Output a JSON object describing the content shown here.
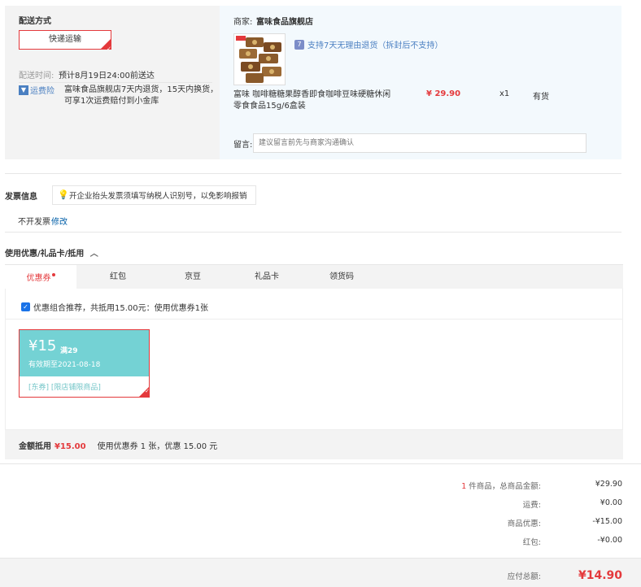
{
  "delivery": {
    "title": "配送方式",
    "method": "快递运输",
    "time_label": "配送时间:",
    "time_value": "预计8月19日24:00前送达",
    "insurance_icon": "shield-icon",
    "insurance_tag": "运费险",
    "insurance_desc_1": "富味食品旗舰店7天内退货，15天内换货，",
    "insurance_desc_2": "可享1次运费赔付到小金库"
  },
  "shop": {
    "merchant_label": "商家:",
    "merchant_name": "富味食品旗舰店",
    "return_policy": "支持7天无理由退货（拆封后不支持）",
    "product_name_1": "富味 咖啡糖糖果醇香即食咖啡豆味硬糖休闲",
    "product_name_2": "零食食品15g/6盒装",
    "price": "¥ 29.90",
    "qty": "x1",
    "stock": "有货",
    "message_label": "留言:",
    "message_placeholder": "建议留言前先与商家沟通确认"
  },
  "invoice": {
    "title": "发票信息",
    "tip": "开企业抬头发票须填写纳税人识别号，以免影响报销",
    "value": "不开发票",
    "edit": "修改"
  },
  "coupon": {
    "title": "使用优惠/礼品卡/抵用",
    "tabs": [
      "优惠券",
      "红包",
      "京豆",
      "礼品卡",
      "领货码"
    ],
    "recommend_text": "优惠组合推荐，共抵用15.00元：使用优惠券1张",
    "card_amount": "¥15",
    "card_condition": "满29",
    "card_valid": "有效期至2021-08-18",
    "card_tags": "[东券]  [限店铺限商品]",
    "discount_label": "金额抵用",
    "discount_value": "¥15.00",
    "discount_desc": "使用优惠券 1 张，优惠 15.00 元"
  },
  "summary": {
    "count": "1",
    "count_suffix": " 件商品，总商品金额:",
    "goods_total": "¥29.90",
    "freight_label": "运费:",
    "freight": "¥0.00",
    "discount_label": "商品优惠:",
    "discount": "-¥15.00",
    "redpacket_label": "红包:",
    "redpacket": "-¥0.00",
    "payable_label": "应付总额:",
    "payable": "¥14.90"
  },
  "colors": {
    "accent": "#e4393c",
    "link": "#005ea7",
    "coupon": "#74d2d4"
  }
}
